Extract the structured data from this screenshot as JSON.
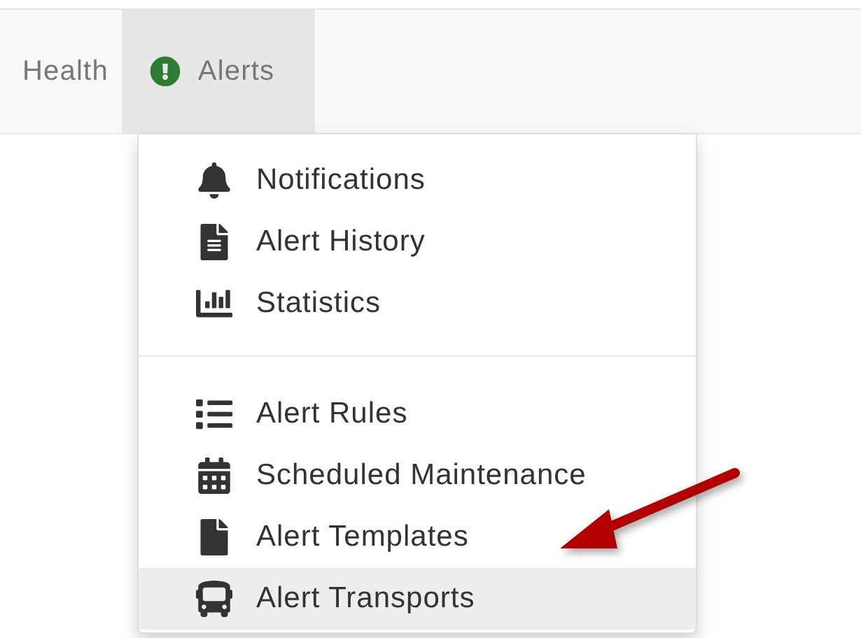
{
  "navbar": {
    "items": [
      {
        "label": "Health",
        "selected": false
      },
      {
        "label": "Alerts",
        "selected": true
      }
    ]
  },
  "dropdown": {
    "sections": [
      {
        "items": [
          {
            "label": "Notifications",
            "highlighted": false
          },
          {
            "label": "Alert History",
            "highlighted": false
          },
          {
            "label": "Statistics",
            "highlighted": false
          }
        ]
      },
      {
        "items": [
          {
            "label": "Alert Rules",
            "highlighted": false
          },
          {
            "label": "Scheduled Maintenance",
            "highlighted": false
          },
          {
            "label": "Alert Templates",
            "highlighted": false
          },
          {
            "label": "Alert Transports",
            "highlighted": true
          }
        ]
      }
    ]
  }
}
